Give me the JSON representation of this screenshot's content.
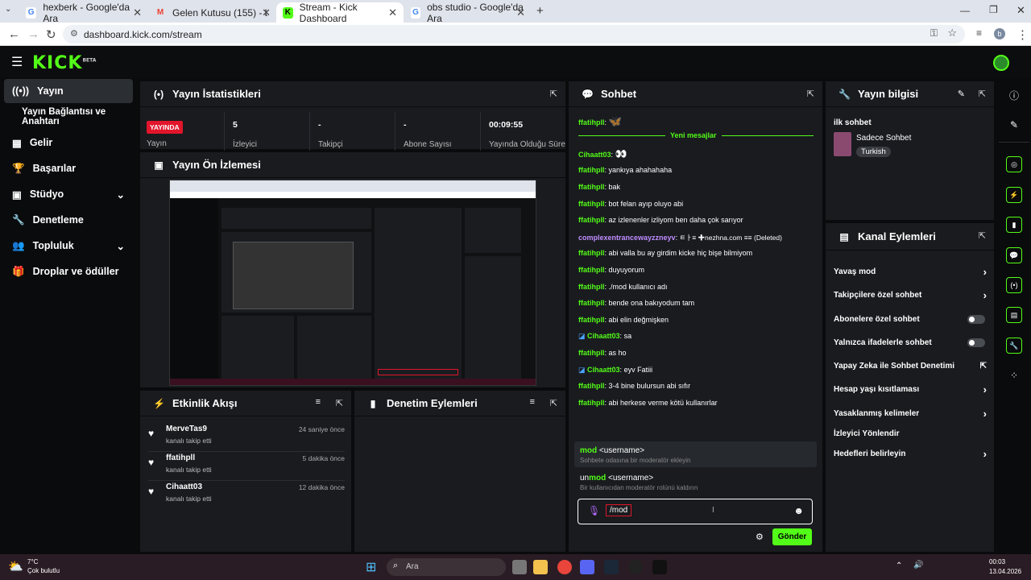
{
  "browser": {
    "tabs": [
      {
        "title": "hexberk - Google'da Ara"
      },
      {
        "title": "Gelen Kutusu (155) - berkdemir"
      },
      {
        "title": "Stream - Kick Dashboard"
      },
      {
        "title": "obs studio - Google'da Ara"
      }
    ],
    "url": "dashboard.kick.com/stream",
    "profile_initial": "b"
  },
  "kick": {
    "logo": "KICK",
    "logo_badge": "BETA"
  },
  "sidebar": {
    "items": [
      {
        "label": "Yayın",
        "icon": "broadcast-icon"
      },
      {
        "label": "Yayın Bağlantısı ve Anahtarı",
        "icon": ""
      },
      {
        "label": "Gelir",
        "icon": "grid-icon"
      },
      {
        "label": "Başarılar",
        "icon": "trophy-icon"
      },
      {
        "label": "Stüdyo",
        "icon": "studio-icon"
      },
      {
        "label": "Denetleme",
        "icon": "wrench-icon"
      },
      {
        "label": "Topluluk",
        "icon": "people-icon"
      },
      {
        "label": "Droplar ve ödüller",
        "icon": "gift-icon"
      }
    ]
  },
  "stats": {
    "title": "Yayın İstatistikleri",
    "live_badge": "YAYINDA",
    "live_label": "Yayın",
    "items": [
      {
        "value": "5",
        "label": "İzleyici"
      },
      {
        "value": "-",
        "label": "Takipçi"
      },
      {
        "value": "-",
        "label": "Abone Sayısı"
      },
      {
        "value": "00:09:55",
        "label": "Yayında Olduğu Süre"
      }
    ]
  },
  "preview": {
    "title": "Yayın Ön İzlemesi"
  },
  "activity": {
    "title": "Etkinlik Akışı",
    "items": [
      {
        "name": "MerveTas9",
        "sub": "kanalı takip etti",
        "time": "24 saniye önce"
      },
      {
        "name": "ffatihpll",
        "sub": "kanalı takip etti",
        "time": "5 dakika önce"
      },
      {
        "name": "Cihaatt03",
        "sub": "kanalı takip etti",
        "time": "12 dakika önce"
      }
    ]
  },
  "moderation": {
    "title": "Denetim Eylemleri"
  },
  "chat": {
    "title": "Sohbet",
    "new_messages": "Yeni mesajlar",
    "messages": [
      {
        "user": "ffatihpll",
        "text": "🦋",
        "color": "#53fc18"
      },
      {
        "user": "Cihaatt03",
        "text": "👀",
        "color": "#53fc18"
      },
      {
        "user": "ffatihpll",
        "text": "yankıya ahahahaha",
        "color": "#53fc18"
      },
      {
        "user": "ffatihpll",
        "text": "bak",
        "color": "#53fc18"
      },
      {
        "user": "ffatihpll",
        "text": "bot felan ayıp oluyo abi",
        "color": "#53fc18"
      },
      {
        "user": "ffatihpll",
        "text": "az izlenenler izliyom ben daha çok sarıyor",
        "color": "#53fc18"
      },
      {
        "user": "complexentrancewayzzneyv",
        "text": "ㅌㅏ≡ ✚nezhna.com ≡≡ (Deleted)",
        "color": "#c08dff"
      },
      {
        "user": "ffatihpll",
        "text": "abi valla bu ay girdim kicke hiç bişe bilmiyom",
        "color": "#53fc18"
      },
      {
        "user": "ffatihpll",
        "text": "duyuyorum",
        "color": "#53fc18"
      },
      {
        "user": "ffatihpll",
        "text": "./mod kullanıcı adı",
        "color": "#53fc18"
      },
      {
        "user": "ffatihpll",
        "text": "bende ona bakıyodum tam",
        "color": "#53fc18"
      },
      {
        "user": "ffatihpll",
        "text": "abi elin değmişken",
        "color": "#53fc18"
      },
      {
        "user": "Cihaatt03",
        "text": "sa",
        "color": "#53fc18"
      },
      {
        "user": "ffatihpll",
        "text": "as ho",
        "color": "#53fc18"
      },
      {
        "user": "Cihaatt03",
        "text": "eyv Fatiii",
        "color": "#53fc18"
      },
      {
        "user": "ffatihpll",
        "text": "3-4 bine bulursun abi sıfır",
        "color": "#53fc18"
      },
      {
        "user": "ffatihpll",
        "text": "abi herkese verme kötü kullanırlar",
        "color": "#53fc18"
      }
    ],
    "suggestions": [
      {
        "cmd_hl": "mod",
        "cmd_rest": " <username>",
        "desc": "Sohbete odasına bir moderatör ekleyin"
      },
      {
        "cmd_pre": "un",
        "cmd_hl": "mod",
        "cmd_rest": " <username>",
        "desc": "Bir kullanıcıdan moderatör rolünü kaldırın"
      }
    ],
    "input_value": "/mod",
    "send_label": "Gönder"
  },
  "stream_info": {
    "title": "Yayın bilgisi",
    "heading": "ilk sohbet",
    "category": "Sadece Sohbet",
    "language": "Turkish"
  },
  "channel_actions": {
    "title": "Kanal Eylemleri",
    "items": [
      {
        "label": "Yavaş mod",
        "kind": "arrow"
      },
      {
        "label": "Takipçilere özel sohbet",
        "kind": "arrow"
      },
      {
        "label": "Abonelere özel sohbet",
        "kind": "toggle"
      },
      {
        "label": "Yalnızca ifadelerle sohbet",
        "kind": "toggle"
      },
      {
        "label": "Yapay Zeka ile Sohbet Denetimi",
        "kind": "external"
      },
      {
        "label": "Hesap yaşı kısıtlaması",
        "kind": "arrow"
      },
      {
        "label": "Yasaklanmış kelimeler",
        "kind": "arrow"
      },
      {
        "label": "İzleyici Yönlendir",
        "kind": "none"
      },
      {
        "label": "Hedefleri belirleyin",
        "kind": "arrow"
      }
    ]
  },
  "taskbar": {
    "weather_temp": "7°C",
    "weather_desc": "Çok bulutlu",
    "search_placeholder": "Ara",
    "time": "00:03",
    "date": "13.04.2026"
  },
  "colors": {
    "accent": "#53fc18",
    "live": "#e1152b",
    "panel": "#191b1f",
    "background": "#0a0b0c"
  }
}
